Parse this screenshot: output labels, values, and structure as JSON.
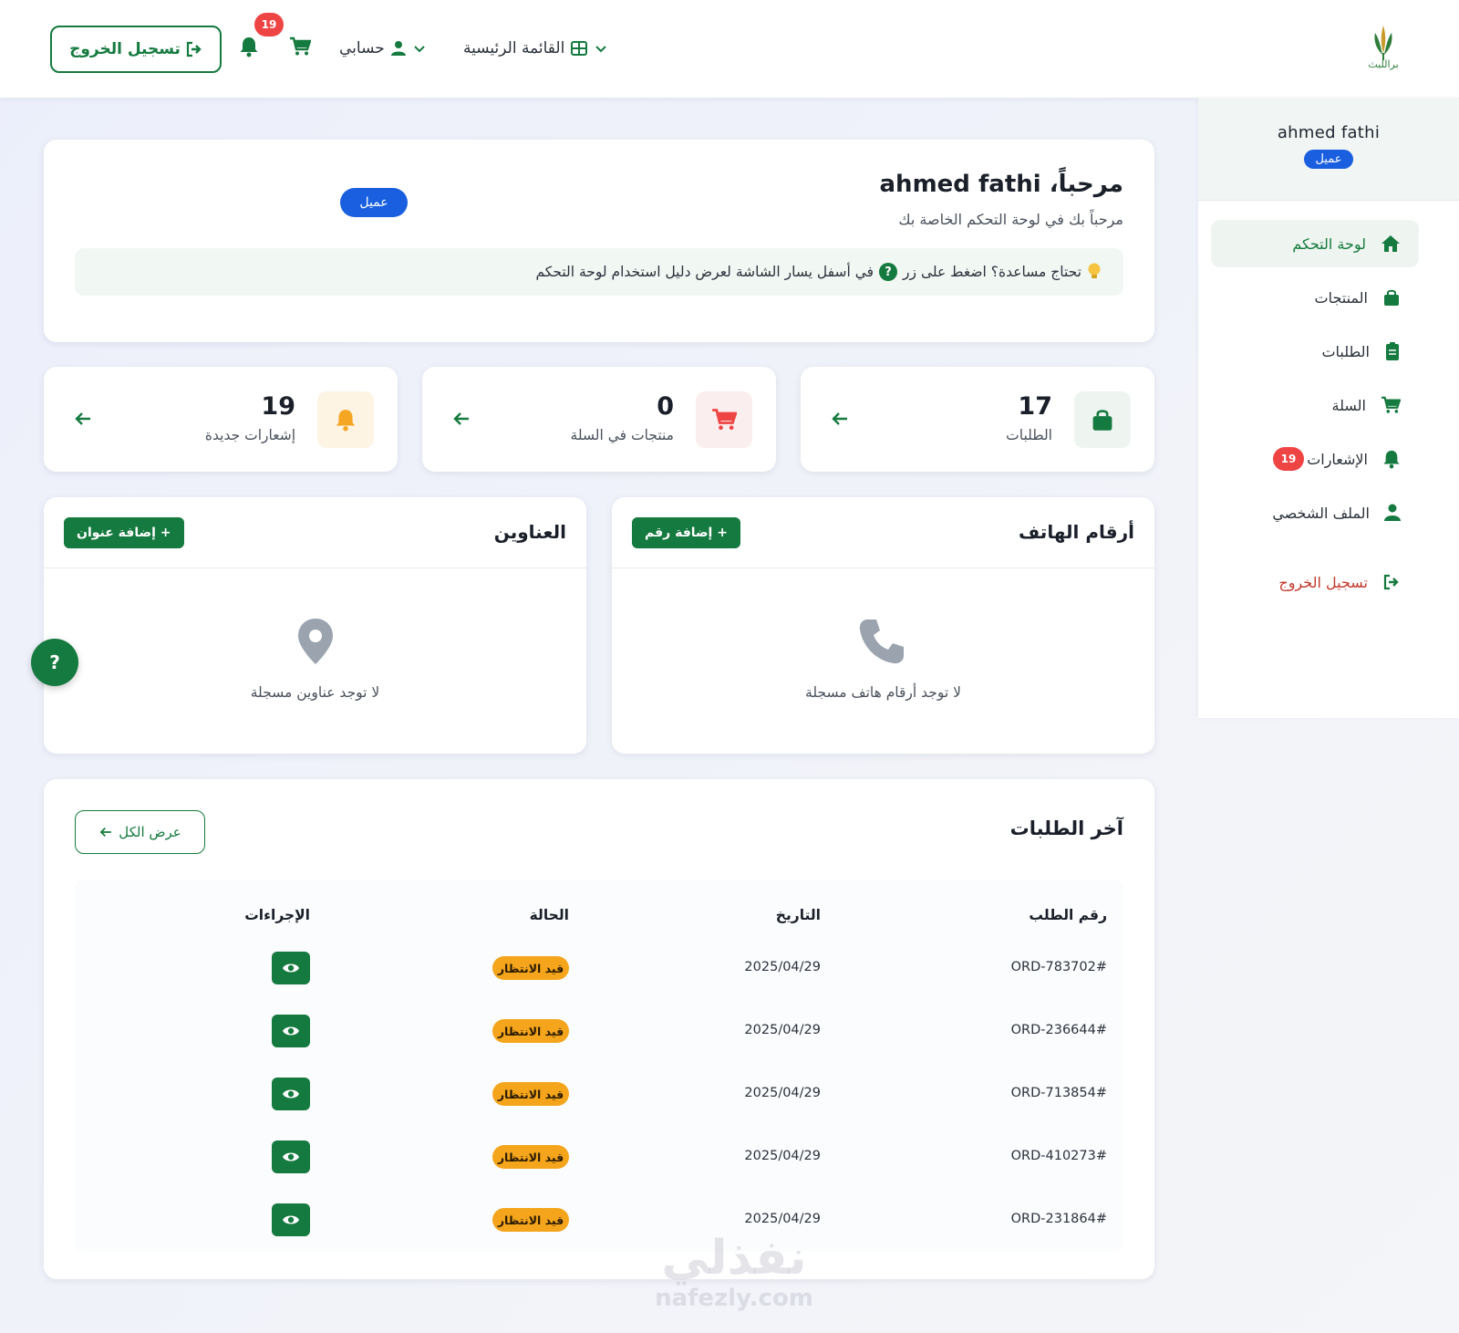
{
  "colors": {
    "brand_green": "#157a3f",
    "role_blue": "#1a5fe0",
    "badge_red": "#ef4444",
    "pending_amber": "#f4a51c",
    "bell_orange": "#f5a623",
    "cart_red": "#ef4444"
  },
  "logo": {
    "text": "براللبث",
    "icon": "wheat-logo"
  },
  "topbar": {
    "main_menu": "القائمة الرئيسية",
    "main_menu_icon": "grid-icon",
    "account_menu": "حسابي",
    "account_icon": "user-icon",
    "cart_icon": "cart-icon",
    "notifications_icon": "bell-icon",
    "notifications_count": "19",
    "logout": "تسجيل الخروج",
    "logout_icon": "sign-out-icon"
  },
  "sidebar": {
    "username": "ahmed fathi",
    "role": "عميل",
    "items": [
      {
        "label": "لوحة التحكم",
        "icon": "home-icon",
        "active": true
      },
      {
        "label": "المنتجات",
        "icon": "shopping-bag-icon"
      },
      {
        "label": "الطلبات",
        "icon": "clipboard-icon"
      },
      {
        "label": "السلة",
        "icon": "cart-icon"
      },
      {
        "label": "الإشعارات",
        "icon": "bell-icon",
        "badge": "19"
      },
      {
        "label": "الملف الشخصي",
        "icon": "user-icon"
      },
      {
        "label": "تسجيل الخروج",
        "icon": "sign-out-icon"
      }
    ]
  },
  "welcome": {
    "title": "مرحباً، ahmed fathi",
    "subtitle": "مرحباً بك في لوحة التحكم الخاصة بك",
    "role": "عميل",
    "help_before": "تحتاج مساعدة؟ اضغط على زر",
    "help_after": "في أسفل يسار الشاشة لعرض دليل استخدام لوحة التحكم",
    "help_icon": "lightbulb-icon"
  },
  "stats": [
    {
      "value": "17",
      "label": "الطلبات",
      "icon": "shopping-bag-icon"
    },
    {
      "value": "0",
      "label": "منتجات في السلة",
      "icon": "cart-icon"
    },
    {
      "value": "19",
      "label": "إشعارات جديدة",
      "icon": "bell-icon"
    }
  ],
  "phones": {
    "title": "أرقام الهاتف",
    "add_button": "+ إضافة رقم",
    "empty_text": "لا توجد أرقام هاتف مسجلة",
    "empty_icon": "phone-icon"
  },
  "addresses": {
    "title": "العناوين",
    "add_button": "+ إضافة عنوان",
    "empty_text": "لا توجد عناوين مسجلة",
    "empty_icon": "map-pin-icon"
  },
  "help_fab": "?",
  "orders": {
    "title": "آخر الطلبات",
    "view_all": "عرض الكل",
    "columns": [
      "رقم الطلب",
      "التاريخ",
      "الحالة",
      "الإجراءات"
    ],
    "rows": [
      {
        "id": "ORD-783702#",
        "date": "2025/04/29",
        "status": "قيد الانتظار"
      },
      {
        "id": "ORD-236644#",
        "date": "2025/04/29",
        "status": "قيد الانتظار"
      },
      {
        "id": "ORD-713854#",
        "date": "2025/04/29",
        "status": "قيد الانتظار"
      },
      {
        "id": "ORD-410273#",
        "date": "2025/04/29",
        "status": "قيد الانتظار"
      },
      {
        "id": "ORD-231864#",
        "date": "2025/04/29",
        "status": "قيد الانتظار"
      }
    ]
  },
  "watermark": {
    "arabic": "نفذلي",
    "latin": "nafezly.com"
  }
}
